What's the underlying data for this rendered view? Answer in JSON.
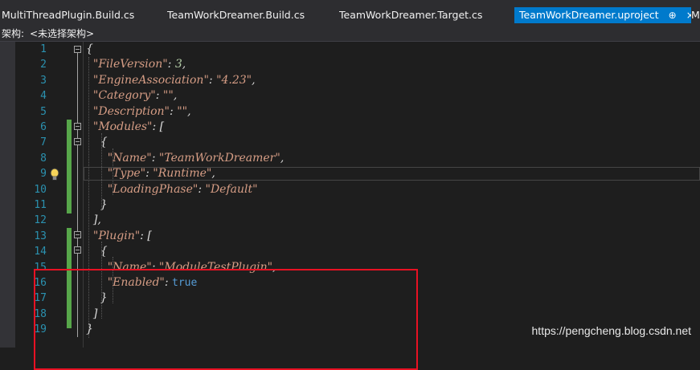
{
  "tabs": [
    {
      "label": "MultiThreadPlugin.Build.cs",
      "active": false
    },
    {
      "label": "TeamWorkDreamer.Build.cs",
      "active": false
    },
    {
      "label": "TeamWorkDreamer.Target.cs",
      "active": false
    },
    {
      "label": "TeamWorkDreamer.uproject",
      "active": true,
      "pin": "⊕",
      "close": "×"
    },
    {
      "label": "M",
      "active": false
    }
  ],
  "navbar": {
    "label": "架构:",
    "value": "<未选择架构>"
  },
  "lines": [
    {
      "n": "1",
      "text": "{"
    },
    {
      "n": "2",
      "text": "  \"FileVersion\": 3,"
    },
    {
      "n": "3",
      "text": "  \"EngineAssociation\": \"4.23\","
    },
    {
      "n": "4",
      "text": "  \"Category\": \"\","
    },
    {
      "n": "5",
      "text": "  \"Description\": \"\","
    },
    {
      "n": "6",
      "text": "  \"Modules\": ["
    },
    {
      "n": "7",
      "text": "    {"
    },
    {
      "n": "8",
      "text": "      \"Name\": \"TeamWorkDreamer\","
    },
    {
      "n": "9",
      "text": "      \"Type\": \"Runtime\","
    },
    {
      "n": "10",
      "text": "      \"LoadingPhase\": \"Default\""
    },
    {
      "n": "11",
      "text": "    }"
    },
    {
      "n": "12",
      "text": "  ],"
    },
    {
      "n": "13",
      "text": "  \"Plugin\": ["
    },
    {
      "n": "14",
      "text": "    {"
    },
    {
      "n": "15",
      "text": "      \"Name\": \"ModuleTestPlugin\","
    },
    {
      "n": "16",
      "text": "      \"Enabled\": true"
    },
    {
      "n": "17",
      "text": "    }"
    },
    {
      "n": "18",
      "text": "  ]"
    },
    {
      "n": "19",
      "text": "}"
    }
  ],
  "watermark": "https://pengcheng.blog.csdn.net",
  "icons": {
    "lightbulb": "lightbulb-icon",
    "collapse": "collapse-toggle-icon"
  },
  "colors": {
    "accent": "#007acc",
    "line_number": "#2b91af",
    "string": "#d69d85",
    "keyword": "#569cd6",
    "highlight_box": "#e81123",
    "change_bar": "#57a64a"
  }
}
